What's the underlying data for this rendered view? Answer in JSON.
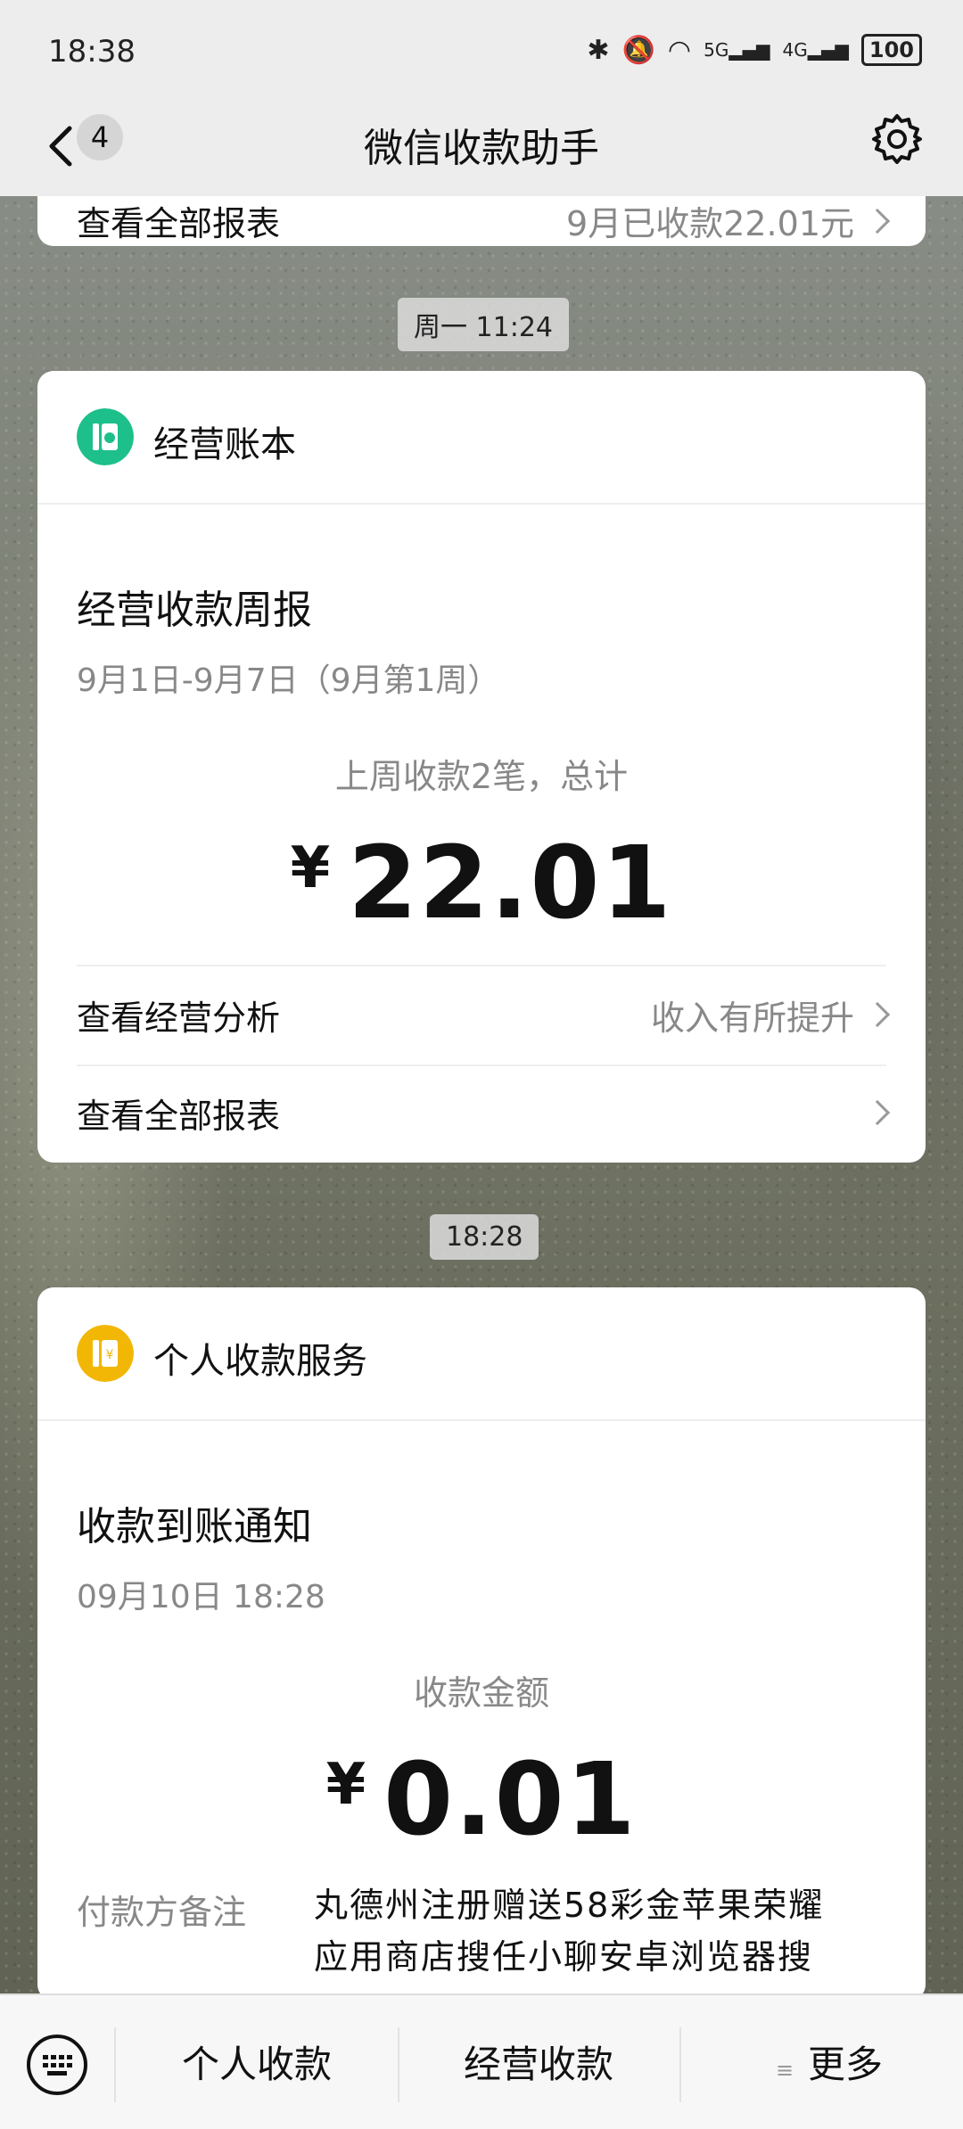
{
  "status_bar": {
    "time": "18:38",
    "signal_5g": "5G",
    "signal_4g": "4G",
    "battery": "100"
  },
  "nav": {
    "back_count": "4",
    "title": "微信收款助手"
  },
  "clipped_card": {
    "label": "查看全部报表",
    "value": "9月已收款22.01元"
  },
  "stamp1": "周一 11:24",
  "card1": {
    "header": "经营账本",
    "title": "经营收款周报",
    "date_range": "9月1日-9月7日（9月第1周）",
    "summary": "上周收款2笔，总计",
    "currency": "¥",
    "amount": "22.01",
    "row1_label": "查看经营分析",
    "row1_value": "收入有所提升",
    "row2_label": "查看全部报表",
    "icon_color": "#1dbf8a"
  },
  "stamp2": "18:28",
  "card2": {
    "header": "个人收款服务",
    "title": "收款到账通知",
    "datetime": "09月10日 18:28",
    "amount_label": "收款金额",
    "currency": "¥",
    "amount": "0.01",
    "remark_label": "付款方备注",
    "remark_line1": "丸德州注册赠送58彩金苹果荣耀",
    "remark_line2": "应用商店搜任小聊安卓浏览器搜",
    "icon_color": "#f2b705"
  },
  "bottom": {
    "tab1": "个人收款",
    "tab2": "经营收款",
    "tab3": "更多"
  }
}
